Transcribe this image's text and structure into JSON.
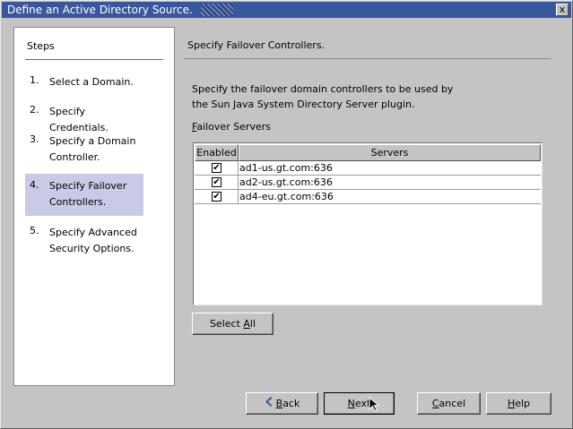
{
  "window": {
    "title": "Define an Active Directory Source.",
    "close_glyph": "x"
  },
  "steps": {
    "header": "Steps",
    "items": [
      {
        "num": "1.",
        "label": "Select a Domain."
      },
      {
        "num": "2.",
        "label": "Specify Credentials."
      },
      {
        "num": "3.",
        "label": "Specify a Domain Controller."
      },
      {
        "num": "4.",
        "label": "Specify Failover Controllers."
      },
      {
        "num": "5.",
        "label": "Specify Advanced Security Options."
      }
    ],
    "current_index": 3
  },
  "content": {
    "title": "Specify Failover Controllers.",
    "description": "Specify the failover domain controllers to be used by the Sun Java System Directory Server plugin.",
    "failover_label_mnemonic": "F",
    "failover_label_rest": "ailover Servers"
  },
  "table": {
    "columns": [
      "Enabled",
      "Servers"
    ],
    "rows": [
      {
        "enabled": true,
        "server": "ad1-us.gt.com:636"
      },
      {
        "enabled": true,
        "server": "ad2-us.gt.com:636"
      },
      {
        "enabled": true,
        "server": "ad4-eu.gt.com:636"
      }
    ],
    "check_glyph": "✔"
  },
  "buttons": {
    "select_all_pre": "Select ",
    "select_all_mnemonic": "A",
    "select_all_post": "ll",
    "back_mnemonic": "B",
    "back_rest": "ack",
    "next_mnemonic": "N",
    "next_rest": "ext",
    "cancel_mnemonic": "C",
    "cancel_rest": "ancel",
    "help_mnemonic": "H",
    "help_rest": "elp"
  },
  "icons": {
    "back": "chevron-left-icon",
    "cursor": "mouse-pointer-icon"
  }
}
